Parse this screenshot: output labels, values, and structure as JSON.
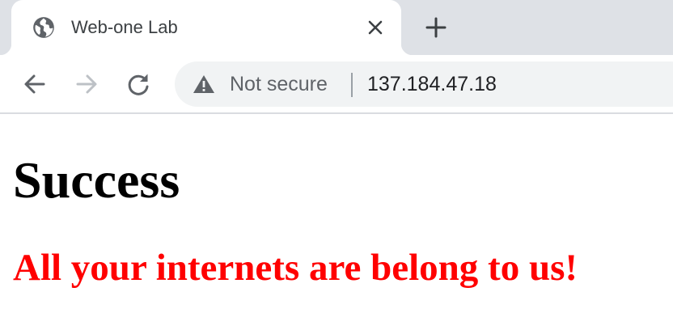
{
  "browser": {
    "tab": {
      "title": "Web-one Lab",
      "favicon": "globe-icon",
      "close_icon": "close-icon"
    },
    "new_tab_icon": "plus-icon",
    "toolbar": {
      "back_icon": "back-arrow-icon",
      "forward_icon": "forward-arrow-icon",
      "reload_icon": "reload-icon"
    },
    "omnibox": {
      "security_icon": "warning-icon",
      "security_text": "Not secure",
      "url": "137.184.47.18"
    }
  },
  "page": {
    "heading": "Success",
    "message": "All your internets are belong to us!",
    "message_color": "#ff0000"
  },
  "colors": {
    "tabstrip_bg": "#dee1e6",
    "omnibox_bg": "#f1f3f4",
    "icon_dark": "#5f6368",
    "icon_disabled": "#bdc1c6"
  }
}
